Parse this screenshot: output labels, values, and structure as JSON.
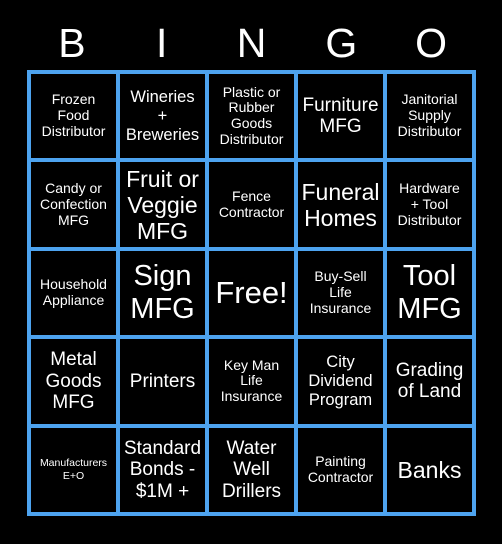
{
  "header": {
    "letters": [
      "B",
      "I",
      "N",
      "G",
      "O"
    ]
  },
  "grid": {
    "rows": 5,
    "columns": 5,
    "border_color": "#4da3ef",
    "cell_background": "#000000",
    "text_color": "#ffffff",
    "cells": [
      {
        "text": "Frozen\nFood\nDistributor",
        "size": "sm"
      },
      {
        "text": "Wineries\n+\nBreweries",
        "size": "md"
      },
      {
        "text": "Plastic or\nRubber\nGoods\nDistributor",
        "size": "sm"
      },
      {
        "text": "Furniture\nMFG",
        "size": "lg"
      },
      {
        "text": "Janitorial\nSupply\nDistributor",
        "size": "sm"
      },
      {
        "text": "Candy or\nConfection\nMFG",
        "size": "sm"
      },
      {
        "text": "Fruit or\nVeggie\nMFG",
        "size": "xl"
      },
      {
        "text": "Fence\nContractor",
        "size": "sm"
      },
      {
        "text": "Funeral\nHomes",
        "size": "xl"
      },
      {
        "text": "Hardware\n+ Tool\nDistributor",
        "size": "sm"
      },
      {
        "text": "Household\nAppliance",
        "size": "sm"
      },
      {
        "text": "Sign\nMFG",
        "size": "xxl"
      },
      {
        "text": "Free!",
        "size": "free"
      },
      {
        "text": "Buy-Sell\nLife\nInsurance",
        "size": "sm"
      },
      {
        "text": "Tool\nMFG",
        "size": "xxl"
      },
      {
        "text": "Metal\nGoods\nMFG",
        "size": "lg"
      },
      {
        "text": "Printers",
        "size": "lg"
      },
      {
        "text": "Key Man\nLife\nInsurance",
        "size": "sm"
      },
      {
        "text": "City\nDividend\nProgram",
        "size": "md"
      },
      {
        "text": "Grading\nof Land",
        "size": "lg"
      },
      {
        "text": "Manufacturers\nE+O",
        "size": "xs"
      },
      {
        "text": "Standard\nBonds -\n$1M +",
        "size": "lg"
      },
      {
        "text": "Water\nWell\nDrillers",
        "size": "lg"
      },
      {
        "text": "Painting\nContractor",
        "size": "sm"
      },
      {
        "text": "Banks",
        "size": "xl"
      }
    ]
  }
}
